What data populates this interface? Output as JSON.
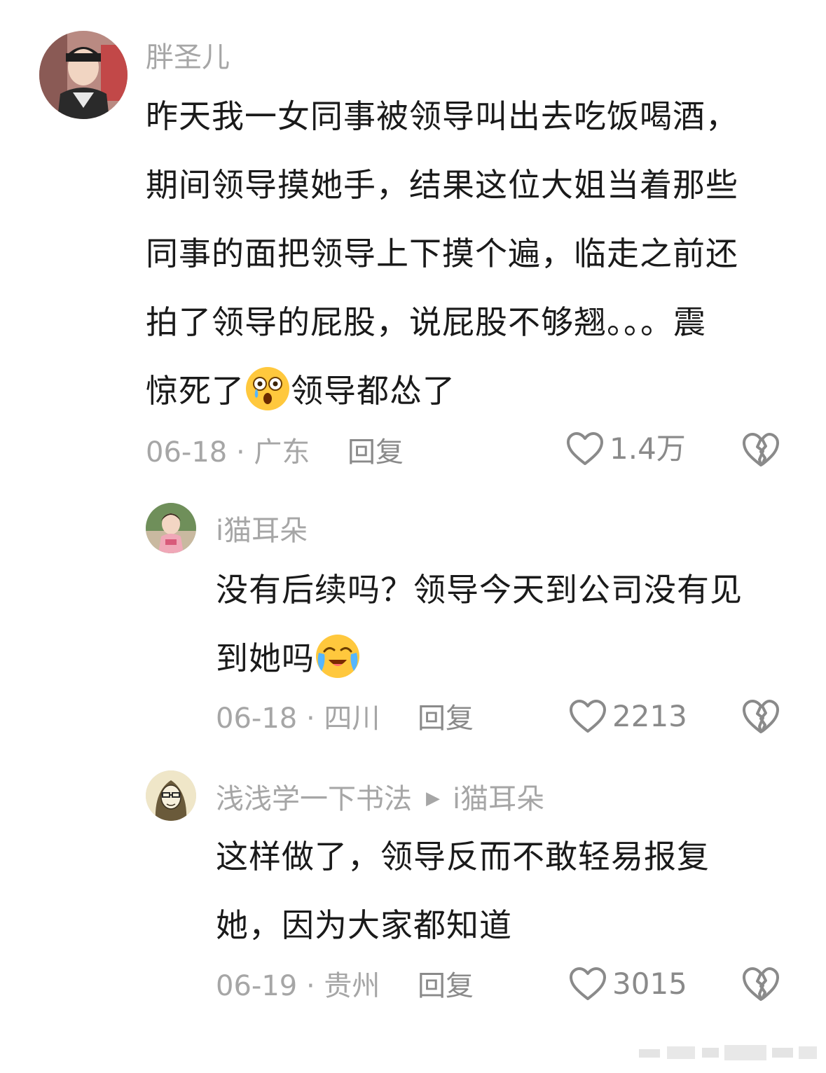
{
  "comments": [
    {
      "username": "胖圣儿",
      "avatar_icon": "avatar-boy",
      "lines": [
        "昨天我一女同事被领导叫出去吃饭喝酒，",
        "期间领导摸她手，结果这位大姐当着那些",
        "同事的面把领导上下摸个遍，临走之前还",
        "拍了领导的屁股，说屁股不够翘。。。震"
      ],
      "last_before_emoji": "惊死了",
      "emoji": "astonished-face",
      "last_after_emoji": "领导都怂了",
      "date": "06-18",
      "location": "广东",
      "reply_label": "回复",
      "likes": "1.4万"
    },
    {
      "username": "i猫耳朵",
      "avatar_icon": "avatar-child",
      "line1": "没有后续吗？领导今天到公司没有见",
      "line2_before_emoji": "到她吗",
      "emoji": "crying-face",
      "date": "06-18",
      "location": "四川",
      "reply_label": "回复",
      "likes": "2213"
    },
    {
      "username": "浅浅学一下书法",
      "reply_arrow": "▶",
      "reply_to": "i猫耳朵",
      "avatar_icon": "avatar-sketch",
      "line1": "这样做了，领导反而不敢轻易报复",
      "line2": "她，因为大家都知道",
      "date": "06-19",
      "location": "贵州",
      "reply_label": "回复",
      "likes": "3015"
    }
  ],
  "separator": " · ",
  "colors": {
    "text": "#1a1a1a",
    "meta": "#a6a6a6",
    "action": "#8a8a8a"
  }
}
